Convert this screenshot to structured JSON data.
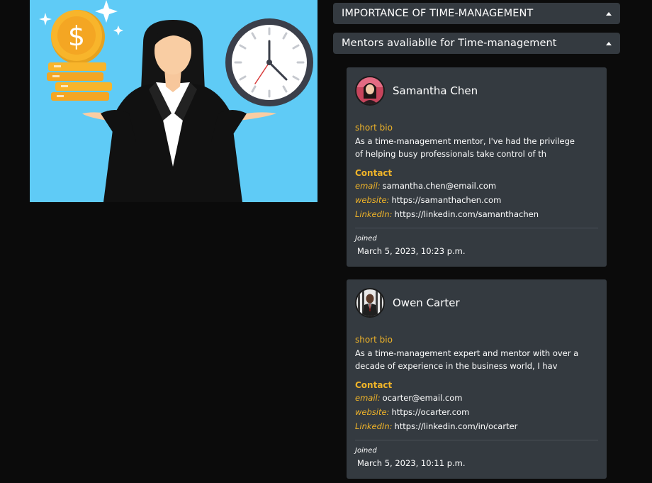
{
  "accordions": [
    {
      "title": "IMPORTANCE OF TIME-MANAGEMENT"
    },
    {
      "title": "Mentors avaliablle for Time-management"
    }
  ],
  "mentors": [
    {
      "name": "Samantha Chen",
      "bio_label": "short bio",
      "bio": "As a time-management mentor, I've had the privilege of helping busy professionals take control of th",
      "contact_label": "Contact",
      "email_key": "email:",
      "email": "samantha.chen@email.com",
      "website_key": "website:",
      "website": "https://samanthachen.com",
      "linkedin_key": "LinkedIn:",
      "linkedin": "https://linkedin.com/samanthachen",
      "joined_label": "Joined",
      "joined": "March 5, 2023, 10:23 p.m."
    },
    {
      "name": "Owen Carter",
      "bio_label": "short bio",
      "bio": "As a time-management expert and mentor with over a decade of experience in the business world, I hav",
      "contact_label": "Contact",
      "email_key": "email:",
      "email": "ocarter@email.com",
      "website_key": "website:",
      "website": "https://ocarter.com",
      "linkedin_key": "LinkedIn:",
      "linkedin": "https://linkedin.com/in/ocarter",
      "joined_label": "Joined",
      "joined": "March 5, 2023, 10:11 p.m."
    }
  ],
  "colors": {
    "page_background": "#0b0b0b",
    "panel": "#343a40",
    "accent": "#f0b429",
    "hero_background": "#5fcbf6"
  },
  "icons": {
    "accordion_toggle": "caret-up-icon"
  }
}
